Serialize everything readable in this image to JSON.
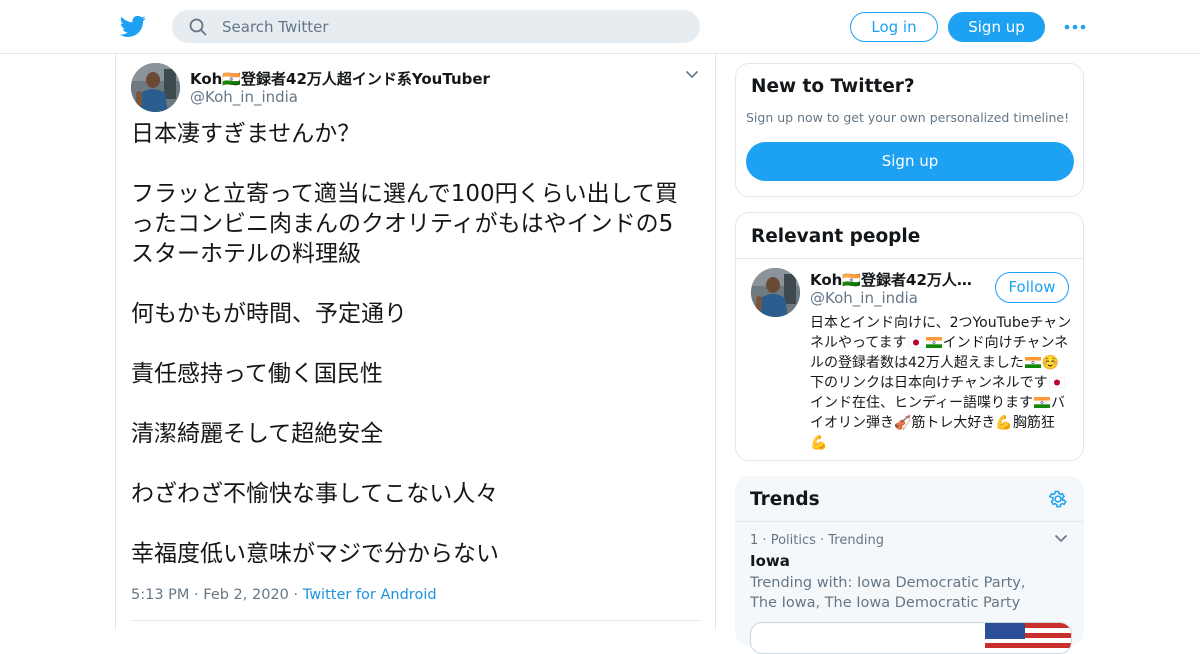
{
  "header": {
    "search_placeholder": "Search Twitter",
    "login_label": "Log in",
    "signup_label": "Sign up",
    "brand_color": "#1da1f2"
  },
  "tweet": {
    "display_name": "Koh🇮🇳登録者42万人超インド系YouTuber",
    "handle": "@Koh_in_india",
    "lines": [
      "日本凄すぎませんか？",
      "フラッと立寄って適当に選んで100円くらい出して買",
      "ったコンビニ肉まんのクオリティがもはやインドの5",
      "スターホテルの料理級",
      "何もかもが時間、予定通り",
      "責任感持って働く国民性",
      "清潔綺麗そして超絶安全",
      "わざわざ不愉快な事してこない人々",
      "幸福度低い意味がマジで分からない"
    ],
    "time": "5:13 PM",
    "date": "Feb 2, 2020",
    "source": "Twitter for Android"
  },
  "new_to_twitter": {
    "title": "New to Twitter?",
    "subtitle": "Sign up now to get your own personalized timeline!",
    "button_label": "Sign up"
  },
  "relevant_people": {
    "title": "Relevant people",
    "person": {
      "display_name": "Koh🇮🇳登録者42万人超...",
      "handle": "@Koh_in_india",
      "follow_label": "Follow",
      "bio_parts": [
        "日本とインド向けに、2つYouTubeチャンネルやってます",
        "インド向けチャンネルの登録者数は42万人超えました",
        "☺️ 下のリンクは日本向けチャンネルです",
        " インド在住、ヒンディー語喋ります",
        "バイオリン弾き🎻筋トレ大好き💪胸筋狂💪"
      ]
    }
  },
  "trends": {
    "title": "Trends",
    "items": [
      {
        "rank": "1",
        "category": "Politics",
        "status": "Trending",
        "name": "Iowa",
        "with": "Trending with: Iowa Democratic Party, The Iowa, The Iowa Democratic Party"
      }
    ]
  }
}
